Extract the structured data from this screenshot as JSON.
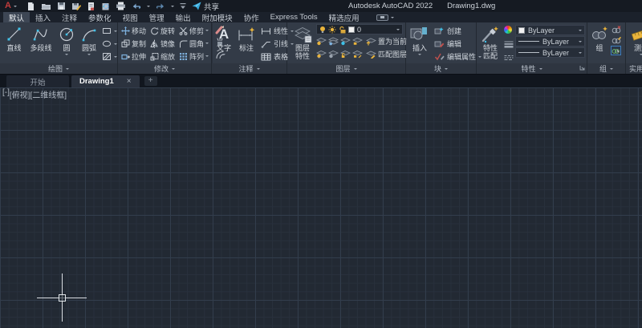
{
  "colors": {
    "accent_cyan": "#3fc1e8",
    "accent_yellow": "#e9b43c",
    "logo_red": "#c13c3c",
    "canvas_bg": "#222933",
    "ribbon_bg": "#333b47"
  },
  "titlebar": {
    "app_title": "Autodesk AutoCAD 2022",
    "doc_title": "Drawing1.dwg",
    "share_label": "共享"
  },
  "ribbon_tabs": [
    "默认",
    "插入",
    "注释",
    "参数化",
    "视图",
    "管理",
    "输出",
    "附加模块",
    "协作",
    "Express Tools",
    "精选应用"
  ],
  "panels": {
    "draw": {
      "label": "绘图",
      "line": "直线",
      "polyline": "多段线",
      "circle": "圆",
      "arc": "圆弧"
    },
    "modify": {
      "label": "修改",
      "move": "移动",
      "rotate": "旋转",
      "trim": "修剪",
      "copy": "复制",
      "mirror": "镜像",
      "fillet": "圆角",
      "stretch": "拉伸",
      "scale": "缩放",
      "array": "阵列"
    },
    "annotate": {
      "label": "注释",
      "text": "文字",
      "dimension": "标注",
      "linear": "线性",
      "leader": "引线",
      "table": "表格"
    },
    "layers": {
      "label": "图层",
      "properties_line1": "图层",
      "properties_line2": "特性",
      "current_layer": "0",
      "set_current": "置为当前",
      "match_layer": "匹配图层"
    },
    "block": {
      "label": "块",
      "insert": "插入",
      "create": "创建",
      "edit": "编辑",
      "edit_attrs": "编辑属性"
    },
    "properties": {
      "label": "特性",
      "match_line1": "特性",
      "match_line2": "匹配",
      "color_value": "ByLayer",
      "lineweight_value": "ByLayer",
      "linetype_value": "ByLayer"
    },
    "group": {
      "label": "组",
      "group": "组"
    },
    "utilities": {
      "label": "实用工具",
      "measure": "测量"
    }
  },
  "doc_tabs": {
    "start": "开始",
    "active": "Drawing1"
  },
  "viewport": {
    "minimize": "[-]",
    "view": "[俯视]",
    "visual_style": "[二维线框]"
  },
  "icons": {
    "logo_glyph": "A",
    "text_glyph": "A",
    "close_glyph": "×",
    "plus_glyph": "+"
  }
}
